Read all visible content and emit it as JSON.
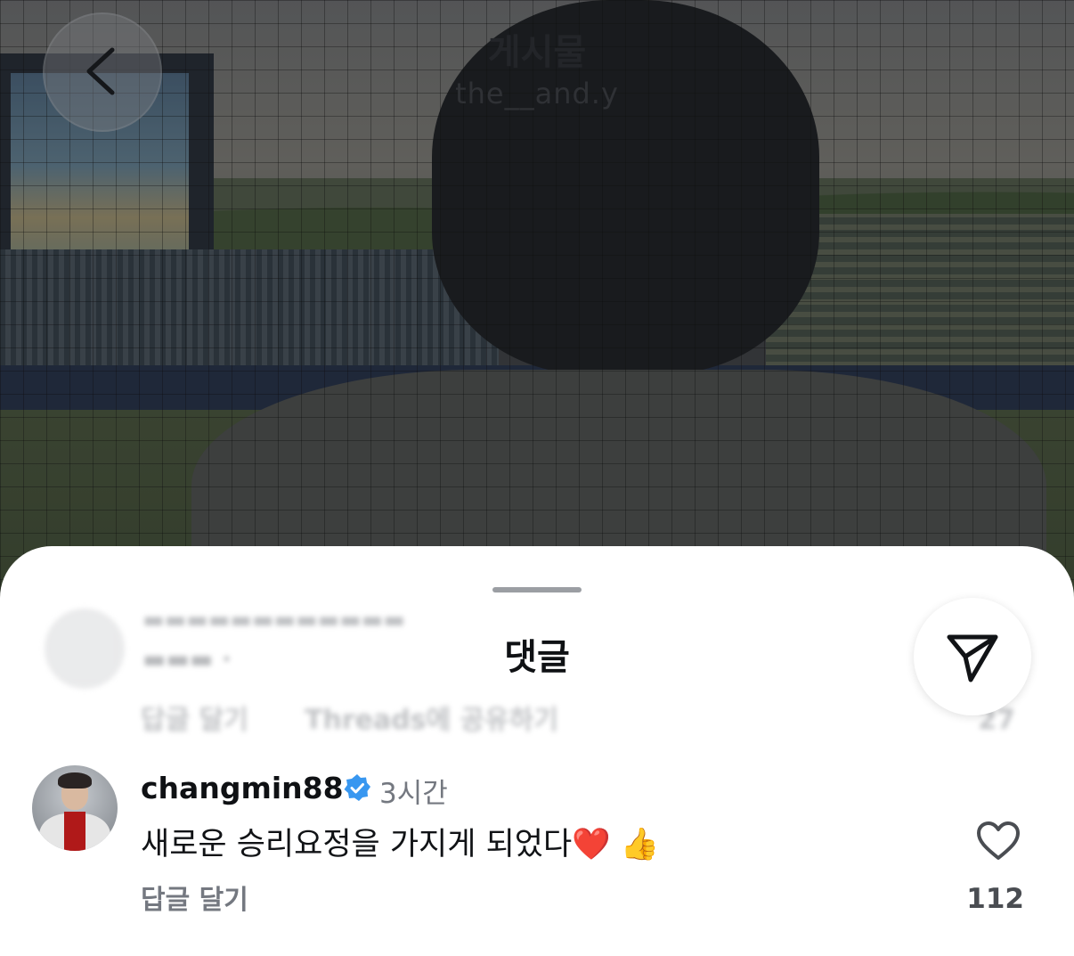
{
  "header": {
    "title": "게시물",
    "subtitle": "the__and.y"
  },
  "sheet": {
    "title": "댓글"
  },
  "previous_comment": {
    "reply_label": "답글 달기",
    "threads_label": "Threads에 공유하기",
    "like_count": "27"
  },
  "comment": {
    "username": "changmin88",
    "time": "3시간",
    "text": "새로운 승리요정을 가지게 되었다❤️ 👍",
    "reply_label": "답글 달기",
    "like_count": "112"
  },
  "icons": {
    "back": "chevron-left-icon",
    "share": "paper-plane-icon",
    "verified": "verified-badge-icon",
    "like": "heart-outline-icon"
  },
  "colors": {
    "verified": "#3897f0",
    "muted_text": "#747880"
  }
}
